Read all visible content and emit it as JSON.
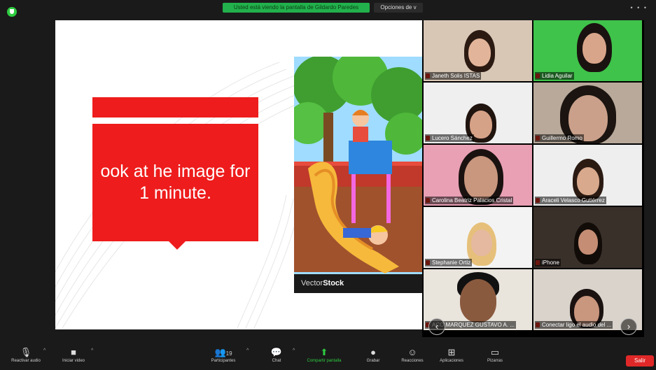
{
  "meeting": {
    "banner_text": "Usted está viendo la pantalla de Gildardo Paredes",
    "options_label": "Opciones de v",
    "window_dots": "• • •"
  },
  "slide": {
    "text": "ook at he image for\n1 minute.",
    "image_label_prefix": "Vector",
    "image_label_brand": "Stock"
  },
  "gallery": {
    "participants": [
      {
        "name": "Janeth Solis ISTAS"
      },
      {
        "name": "Lidia Aguilar"
      },
      {
        "name": "Lucero Sánchez"
      },
      {
        "name": "Guillermo Romo"
      },
      {
        "name": "Carolina Beatriz Palacios Cristal"
      },
      {
        "name": "Araceli Velasco Gutiérrez"
      },
      {
        "name": "Stephanie Ortiz"
      },
      {
        "name": "iPhone"
      },
      {
        "name": "ACO MARQUEZ GUSTAVO A. ..."
      },
      {
        "name": "Conectar ligo el audio del ..."
      }
    ],
    "prev_icon": "chevron-left-icon",
    "next_icon": "chevron-right-icon"
  },
  "toolbar": {
    "mute_label": "Reactivar audio",
    "video_label": "Iniciar video",
    "participants_label": "Participantes",
    "participants_count": "19",
    "chat_label": "Chat",
    "share_label": "Compartir pantalla",
    "record_label": "Grabar",
    "reactions_label": "Reacciones",
    "apps_label": "Aplicaciones",
    "whiteboards_label": "Pizarras",
    "leave_label": "Salir"
  },
  "colors": {
    "slide_red": "#ee1c1c",
    "share_green": "#22b14c",
    "leave_red": "#e02828"
  }
}
